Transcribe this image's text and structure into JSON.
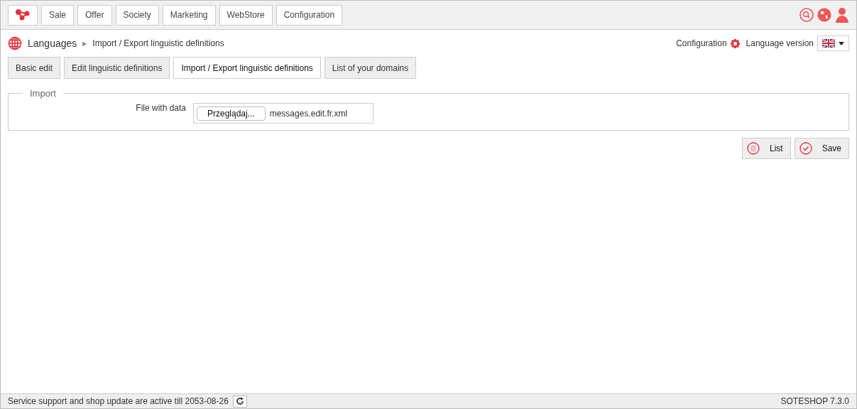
{
  "top_menu": [
    {
      "label": "Sale"
    },
    {
      "label": "Offer"
    },
    {
      "label": "Society"
    },
    {
      "label": "Marketing"
    },
    {
      "label": "WebStore"
    },
    {
      "label": "Configuration"
    }
  ],
  "breadcrumb": {
    "section": "Languages",
    "separator": "▶",
    "current": "Import / Export linguistic definitions"
  },
  "header_right": {
    "configuration": "Configuration",
    "language_version": "Language version"
  },
  "tabs": [
    {
      "label": "Basic edit",
      "selected": false
    },
    {
      "label": "Edit linguistic definitions",
      "selected": false
    },
    {
      "label": "Import / Export linguistic definitions",
      "selected": true
    },
    {
      "label": "List of your domains",
      "selected": false
    }
  ],
  "import": {
    "legend": "Import",
    "field_label": "File with data",
    "browse_button": "Przeglądaj...",
    "file_name": "messages.edit.fr.xml"
  },
  "actions": [
    {
      "kind": "list",
      "label": "List"
    },
    {
      "kind": "save",
      "label": "Save"
    }
  ],
  "status_bar": {
    "message": "Service support and shop update are active till 2053-08-26",
    "version": "SOTESHOP 7.3.0"
  }
}
